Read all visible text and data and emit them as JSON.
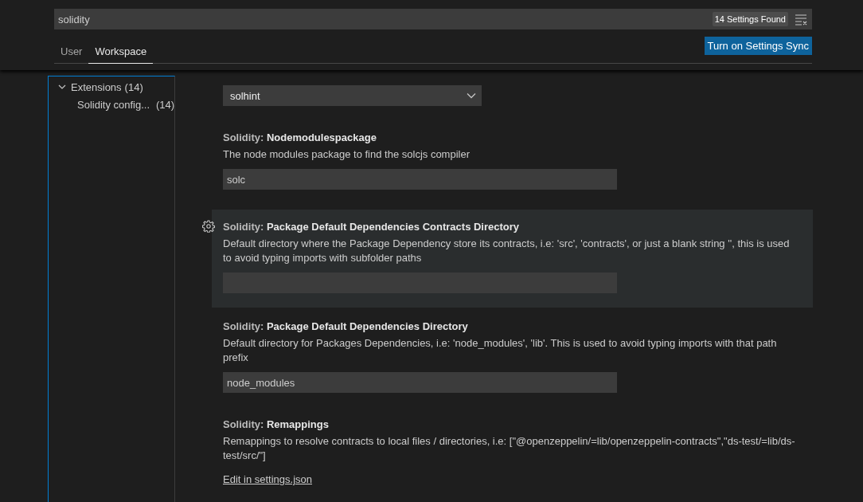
{
  "search": {
    "value": "solidity",
    "count": "14 Settings Found"
  },
  "tabs": [
    {
      "label": "User",
      "selected": false
    },
    {
      "label": "Workspace",
      "selected": true
    }
  ],
  "sync_button": "Turn on Settings Sync",
  "tree": [
    {
      "label": "Extensions",
      "count": "(14)",
      "expanded": true,
      "children": [
        {
          "label": "Solidity config...",
          "count": "(14)"
        }
      ]
    }
  ],
  "settings": [
    {
      "kind": "select",
      "focused": false,
      "value": "solhint"
    },
    {
      "kind": "text",
      "focused": false,
      "category": "Solidity:",
      "name": "Nodemodulespackage",
      "description": "The node modules package to find the solcjs compiler",
      "value": "solc"
    },
    {
      "kind": "text",
      "focused": true,
      "category": "Solidity:",
      "name": "Package Default Dependencies Contracts Directory",
      "description": "Default directory where the Package Dependency store its contracts, i.e: 'src', 'contracts', or just a blank string '', this is used to avoid typing imports with subfolder paths"
    },
    {
      "kind": "text",
      "focused": false,
      "category": "Solidity:",
      "name": "Package Default Dependencies Directory",
      "description": "Default directory for Packages Dependencies, i.e: 'node_modules', 'lib'. This is used to avoid typing imports with that path prefix",
      "value": "node_modules"
    },
    {
      "kind": "link",
      "focused": false,
      "category": "Solidity:",
      "name": "Remappings",
      "description": "Remappings to resolve contracts to local files / directories, i.e: [\"@openzeppelin/=lib/openzeppelin-contracts\",\"ds-test/=lib/ds-test/src/\"]",
      "link": "Edit in settings.json"
    }
  ]
}
